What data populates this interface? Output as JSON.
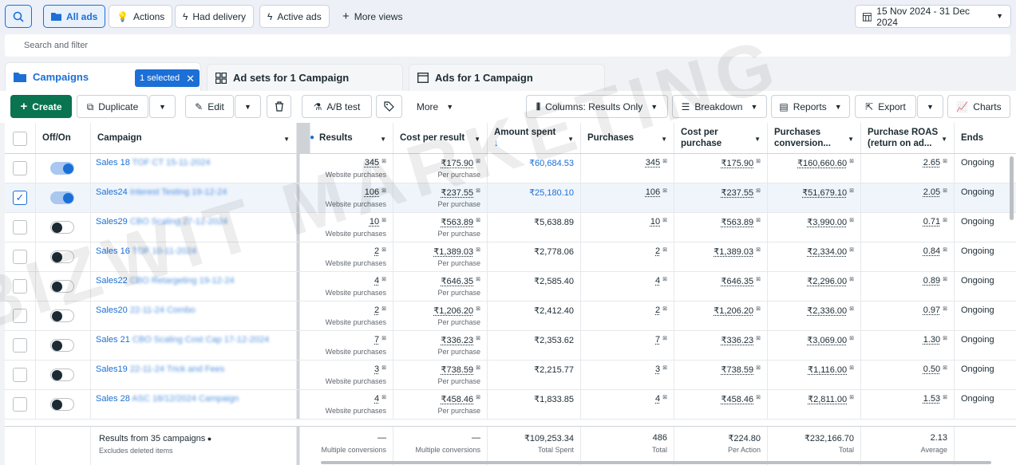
{
  "topbar": {
    "search_icon": "search-icon",
    "views": [
      {
        "label": "All ads",
        "icon": "folder-icon",
        "active": true
      },
      {
        "label": "Actions",
        "icon": "lightbulb-icon",
        "active": false
      },
      {
        "label": "Had delivery",
        "icon": "bolt-icon",
        "active": false
      },
      {
        "label": "Active ads",
        "icon": "bolt-icon",
        "active": false
      }
    ],
    "more_views": "More views",
    "date_range": "15 Nov 2024 - 31 Dec 2024"
  },
  "search": {
    "placeholder": "Search and filter"
  },
  "tabs": {
    "campaigns": "Campaigns",
    "selected_badge": "1 selected",
    "ad_sets": "Ad sets for 1 Campaign",
    "ads": "Ads for 1 Campaign"
  },
  "toolbar": {
    "create": "Create",
    "duplicate": "Duplicate",
    "edit": "Edit",
    "ab_test": "A/B test",
    "more": "More",
    "columns": "Columns: Results Only",
    "breakdown": "Breakdown",
    "reports": "Reports",
    "export": "Export",
    "charts": "Charts"
  },
  "table": {
    "headers": {
      "offon": "Off/On",
      "campaign": "Campaign",
      "results": "Results",
      "cost_per_result": "Cost per result",
      "amount_spent": "Amount spent",
      "purchases": "Purchases",
      "cost_per_purchase_1": "Cost per",
      "cost_per_purchase_2": "purchase",
      "conv_1": "Purchases",
      "conv_2": "conversion...",
      "roas_1": "Purchase ROAS",
      "roas_2": "(return on ad...",
      "ends": "Ends"
    },
    "result_type": "Website purchases",
    "per_purchase": "Per purchase",
    "rows": [
      {
        "selected": false,
        "on": true,
        "name": "Sales 18",
        "name_rest": "TOF CT 15-11-2024",
        "results": "345",
        "cpr": "₹175.90",
        "spent": "₹60,684.53",
        "spent_blue": true,
        "purchases": "345",
        "cpp": "₹175.90",
        "conv": "₹160,660.60",
        "roas": "2.65",
        "ends": "Ongoing"
      },
      {
        "selected": true,
        "on": true,
        "name": "Sales24",
        "name_rest": "Interest Testing 19-12-24",
        "results": "106",
        "cpr": "₹237.55",
        "spent": "₹25,180.10",
        "spent_blue": true,
        "purchases": "106",
        "cpp": "₹237.55",
        "conv": "₹51,679.10",
        "roas": "2.05",
        "ends": "Ongoing"
      },
      {
        "selected": false,
        "on": false,
        "name": "Sales29",
        "name_rest": "CBO Scaling 27-12-2024",
        "results": "10",
        "cpr": "₹563.89",
        "spent": "₹5,638.89",
        "spent_blue": false,
        "purchases": "10",
        "cpp": "₹563.89",
        "conv": "₹3,990.00",
        "roas": "0.71",
        "ends": "Ongoing"
      },
      {
        "selected": false,
        "on": false,
        "name": "Sales 16",
        "name_rest": "TOF 10-11-2024",
        "results": "2",
        "cpr": "₹1,389.03",
        "spent": "₹2,778.06",
        "spent_blue": false,
        "purchases": "2",
        "cpp": "₹1,389.03",
        "conv": "₹2,334.00",
        "roas": "0.84",
        "ends": "Ongoing"
      },
      {
        "selected": false,
        "on": false,
        "name": "Sales22",
        "name_rest": "CBO Retargeting 19-12-24",
        "results": "4",
        "cpr": "₹646.35",
        "spent": "₹2,585.40",
        "spent_blue": false,
        "purchases": "4",
        "cpp": "₹646.35",
        "conv": "₹2,296.00",
        "roas": "0.89",
        "ends": "Ongoing"
      },
      {
        "selected": false,
        "on": false,
        "name": "Sales20",
        "name_rest": "22-11-24 Combo",
        "results": "2",
        "cpr": "₹1,206.20",
        "spent": "₹2,412.40",
        "spent_blue": false,
        "purchases": "2",
        "cpp": "₹1,206.20",
        "conv": "₹2,336.00",
        "roas": "0.97",
        "ends": "Ongoing"
      },
      {
        "selected": false,
        "on": false,
        "name": "Sales 21",
        "name_rest": "CBO Scaling Cost Cap 17-12-2024",
        "results": "7",
        "cpr": "₹336.23",
        "spent": "₹2,353.62",
        "spent_blue": false,
        "purchases": "7",
        "cpp": "₹336.23",
        "conv": "₹3,069.00",
        "roas": "1.30",
        "ends": "Ongoing"
      },
      {
        "selected": false,
        "on": false,
        "name": "Sales19",
        "name_rest": "22-11-24 Trick and Fees",
        "results": "3",
        "cpr": "₹738.59",
        "spent": "₹2,215.77",
        "spent_blue": false,
        "purchases": "3",
        "cpp": "₹738.59",
        "conv": "₹1,116.00",
        "roas": "0.50",
        "ends": "Ongoing"
      },
      {
        "selected": false,
        "on": false,
        "name": "Sales 28",
        "name_rest": "ASC 18/12/2024 Campaign",
        "results": "4",
        "cpr": "₹458.46",
        "spent": "₹1,833.85",
        "spent_blue": false,
        "purchases": "4",
        "cpp": "₹458.46",
        "conv": "₹2,811.00",
        "roas": "1.53",
        "ends": "Ongoing"
      }
    ],
    "totals": {
      "label": "Results from 35 campaigns",
      "note": "Excludes deleted items",
      "results": "—",
      "results_sub": "Multiple conversions",
      "cpr": "—",
      "cpr_sub": "Multiple conversions",
      "spent": "₹109,253.34",
      "spent_sub": "Total Spent",
      "purchases": "486",
      "purchases_sub": "Total",
      "cpp": "₹224.80",
      "cpp_sub": "Per Action",
      "conv": "₹232,166.70",
      "conv_sub": "Total",
      "roas": "2.13",
      "roas_sub": "Average"
    }
  },
  "watermark": "BIZWIT MARKETING",
  "colors": {
    "accent": "#1b6fd6",
    "create": "#0a7350"
  }
}
